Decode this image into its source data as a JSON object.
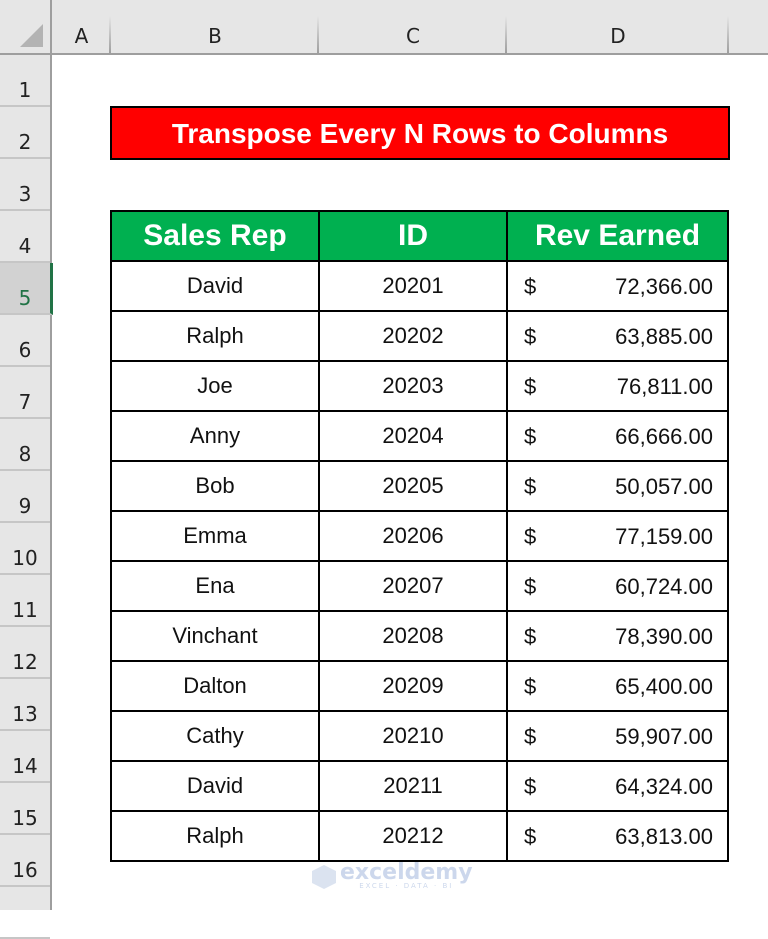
{
  "sheet": {
    "columns": [
      "A",
      "B",
      "C",
      "D"
    ],
    "rows": [
      "1",
      "2",
      "3",
      "4",
      "5",
      "6",
      "7",
      "8",
      "9",
      "10",
      "11",
      "12",
      "13",
      "14",
      "15",
      "16"
    ],
    "selected_row": "5"
  },
  "title": "Transpose Every N Rows to Columns",
  "table": {
    "headers": [
      "Sales Rep",
      "ID",
      "Rev Earned"
    ],
    "currency_symbol": "$",
    "rows": [
      {
        "name": "David",
        "id": "20201",
        "rev": "72,366.00"
      },
      {
        "name": "Ralph",
        "id": "20202",
        "rev": "63,885.00"
      },
      {
        "name": "Joe",
        "id": "20203",
        "rev": "76,811.00"
      },
      {
        "name": "Anny",
        "id": "20204",
        "rev": "66,666.00"
      },
      {
        "name": "Bob",
        "id": "20205",
        "rev": "50,057.00"
      },
      {
        "name": "Emma",
        "id": "20206",
        "rev": "77,159.00"
      },
      {
        "name": "Ena",
        "id": "20207",
        "rev": "60,724.00"
      },
      {
        "name": "Vinchant",
        "id": "20208",
        "rev": "78,390.00"
      },
      {
        "name": "Dalton",
        "id": "20209",
        "rev": "65,400.00"
      },
      {
        "name": "Cathy",
        "id": "20210",
        "rev": "59,907.00"
      },
      {
        "name": "David",
        "id": "20211",
        "rev": "64,324.00"
      },
      {
        "name": "Ralph",
        "id": "20212",
        "rev": "63,813.00"
      }
    ]
  },
  "colors": {
    "title_bg": "#ff0000",
    "header_bg": "#00b050",
    "selection": "#217346"
  },
  "watermark": {
    "brand": "exceldemy",
    "tagline": "EXCEL · DATA · BI"
  }
}
